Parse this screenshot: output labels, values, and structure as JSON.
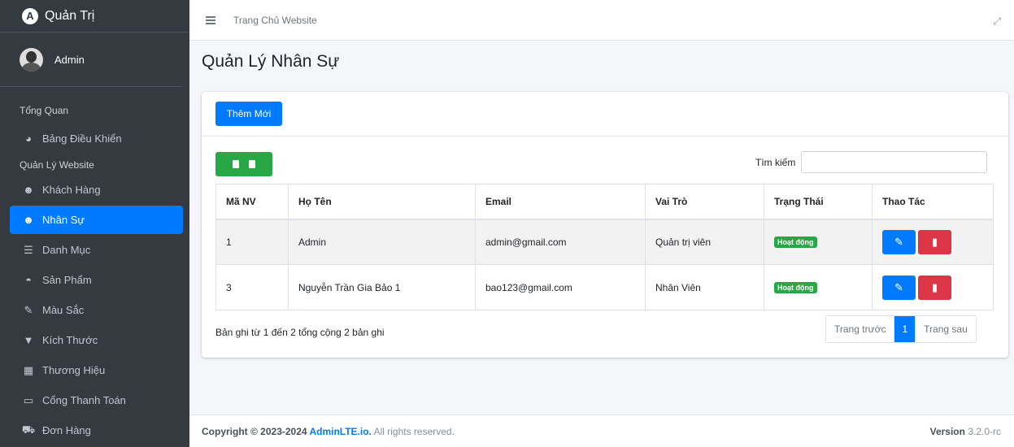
{
  "brand": {
    "name": "Quản Trị",
    "logo": "A"
  },
  "user": {
    "name": "Admin"
  },
  "sidebar": {
    "headers": [
      "Tổng Quan",
      "Quản Lý Website"
    ],
    "items": [
      {
        "label": "Bảng Điều Khiển",
        "icon": "dashboard-icon"
      },
      {
        "label": "Khách Hàng",
        "icon": "users-icon"
      },
      {
        "label": "Nhân Sự",
        "icon": "staff-icon"
      },
      {
        "label": "Danh Mục",
        "icon": "list-icon"
      },
      {
        "label": "Sản Phẩm",
        "icon": "product-icon"
      },
      {
        "label": "Màu Sắc",
        "icon": "brush-icon"
      },
      {
        "label": "Kích Thước",
        "icon": "shirt-icon"
      },
      {
        "label": "Thương Hiệu",
        "icon": "building-icon"
      },
      {
        "label": "Cổng Thanh Toán",
        "icon": "payment-icon"
      },
      {
        "label": "Đơn Hàng",
        "icon": "cart-icon"
      }
    ]
  },
  "topbar": {
    "home_link": "Trang Chủ Website"
  },
  "page": {
    "title": "Quản Lý Nhân Sự"
  },
  "card": {
    "add_button": "Thêm Mới",
    "search_label": "Tìm kiếm",
    "search_value": ""
  },
  "table": {
    "headers": [
      "Mã NV",
      "Họ Tên",
      "Email",
      "Vai Trò",
      "Trạng Thái",
      "Thao Tác"
    ],
    "rows": [
      {
        "id": "1",
        "name": "Admin",
        "email": "admin@gmail.com",
        "role": "Quản trị viên",
        "status": "Hoạt động"
      },
      {
        "id": "3",
        "name": "Nguyễn Trần Gia Bảo 1",
        "email": "bao123@gmail.com",
        "role": "Nhân Viên",
        "status": "Hoạt động"
      }
    ]
  },
  "pagination": {
    "info": "Bản ghi từ 1 đến 2 tổng cộng 2 bản ghi",
    "prev": "Trang trước",
    "current": "1",
    "next": "Trang sau"
  },
  "footer": {
    "copyright_prefix": "Copyright © 2023-2024 ",
    "brand": "AdminLTE.io.",
    "suffix": " All rights reserved.",
    "version_label": "Version",
    "version": "3.2.0-rc"
  },
  "colors": {
    "primary": "#007bff",
    "success": "#28a745",
    "danger": "#dc3545",
    "sidebar": "#343a40"
  }
}
